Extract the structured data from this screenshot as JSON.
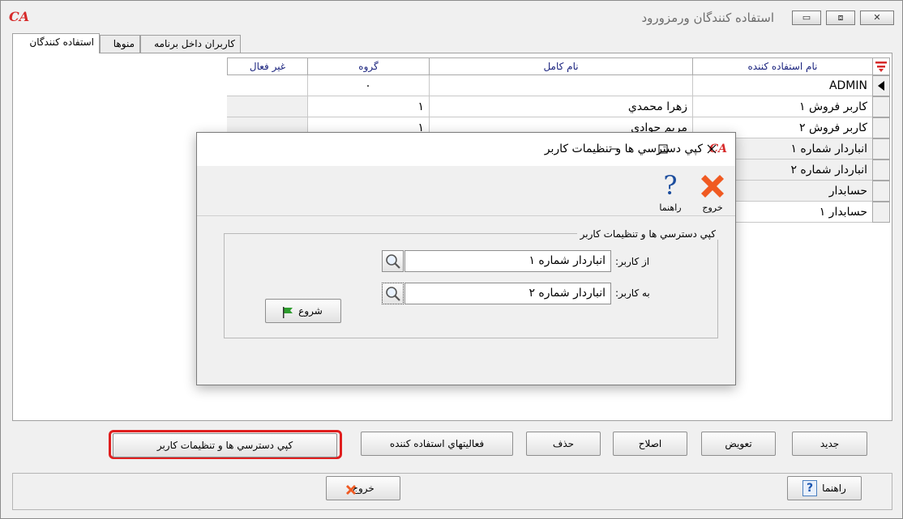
{
  "window": {
    "title": "استفاده كنندگان ورمزورود",
    "logo": "CA",
    "controls": {
      "minimize": "▭",
      "restore": "⧈",
      "close": "✕"
    }
  },
  "tabs": [
    {
      "label": "استفاده كنندگان",
      "active": true
    },
    {
      "label": "منوها",
      "active": false
    },
    {
      "label": "كاربران داخل برنامه",
      "active": false
    }
  ],
  "grid": {
    "columns": [
      "نام استفاده كننده",
      "نام كامل",
      "گروه",
      "غير فعال"
    ],
    "rows": [
      {
        "username": "ADMIN",
        "fullname": "",
        "group": "۰",
        "inactive": ""
      },
      {
        "username": "كاربر فروش ۱",
        "fullname": "زهرا محمدي",
        "group": "۱",
        "inactive": ""
      },
      {
        "username": "كاربر فروش ۲",
        "fullname": "مريم جوادي",
        "group": "۱",
        "inactive": ""
      },
      {
        "username": "انباردار شماره ۱",
        "fullname": "",
        "group": "",
        "inactive": ""
      },
      {
        "username": "انباردار شماره ۲",
        "fullname": "",
        "group": "",
        "inactive": ""
      },
      {
        "username": "حسابدار",
        "fullname": "",
        "group": "",
        "inactive": ""
      },
      {
        "username": "حسابدار ۱",
        "fullname": "",
        "group": "",
        "inactive": ""
      }
    ]
  },
  "actions": {
    "new": "جديد",
    "replace": "تعويض",
    "edit": "اصلاح",
    "delete": "حذف",
    "activities": "فعاليتهاي استفاده كننده",
    "copy_access": "كپي دسترسي ها و تنظيمات كاربر"
  },
  "footer": {
    "help": "راهنما",
    "exit": "خروج"
  },
  "dialog": {
    "title": "كپي دسترسي ها و تنظيمات كاربر",
    "logo": "CA",
    "toolbar": {
      "exit": "خروج",
      "help": "راهنما"
    },
    "group_title": "كپي دسترسي ها و تنظيمات كاربر",
    "from_label": "از كاربر:",
    "from_value": "انباردار شماره ۱",
    "to_label": "به كاربر:",
    "to_value": "انباردار شماره ۲",
    "start": "شروع"
  },
  "colors": {
    "accent_red": "#d62a2a",
    "highlight_outline": "#e01e1e",
    "header_text": "#1a237e",
    "flag_green": "#2e9d2e"
  },
  "icons": [
    "app-logo-icon",
    "filter-icon",
    "row-pointer-icon",
    "search-icon",
    "help-icon",
    "exit-icon",
    "flag-icon"
  ]
}
